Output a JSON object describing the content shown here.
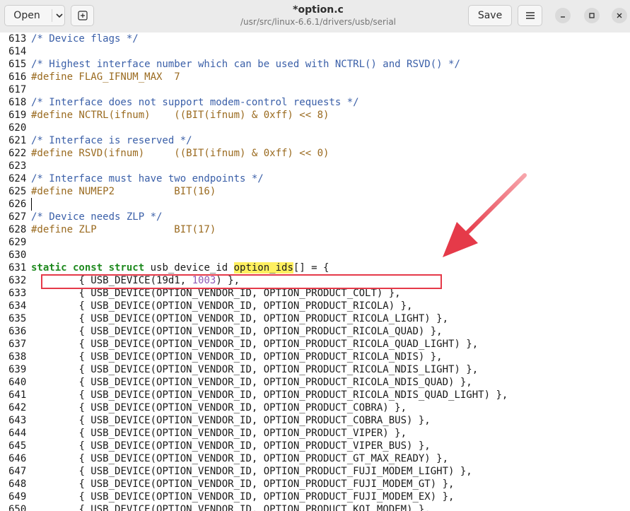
{
  "header": {
    "open_label": "Open",
    "save_label": "Save",
    "title": "*option.c",
    "subtitle": "/usr/src/linux-6.6.1/drivers/usb/serial"
  },
  "colors": {
    "comment": "#3a5fa8",
    "preproc": "#9a6a1f",
    "keyword": "#1f8a1f",
    "number": "#8e5ab5",
    "search_highlight": "#fff060",
    "annotation": "#e53a49"
  },
  "icons": {
    "open_chevron": "chevron-down-icon",
    "new_tab": "new-tab-icon",
    "menu": "hamburger-menu-icon",
    "minimize": "minimize-icon",
    "maximize": "maximize-icon",
    "close": "close-icon"
  },
  "editor": {
    "current_line": 626,
    "lines": [
      {
        "n": "613",
        "parts": [
          {
            "t": "/* Device flags */",
            "c": "comment"
          }
        ]
      },
      {
        "n": "614",
        "parts": []
      },
      {
        "n": "615",
        "parts": [
          {
            "t": "/* Highest interface number which can be used with NCTRL() and RSVD() */",
            "c": "comment"
          }
        ]
      },
      {
        "n": "616",
        "parts": [
          {
            "t": "#define FLAG_IFNUM_MAX  7",
            "c": "preproc"
          }
        ]
      },
      {
        "n": "617",
        "parts": []
      },
      {
        "n": "618",
        "parts": [
          {
            "t": "/* Interface does not support modem-control requests */",
            "c": "comment"
          }
        ]
      },
      {
        "n": "619",
        "parts": [
          {
            "t": "#define NCTRL(ifnum)    ((BIT(ifnum) & 0xff) << 8)",
            "c": "preproc"
          }
        ]
      },
      {
        "n": "620",
        "parts": []
      },
      {
        "n": "621",
        "parts": [
          {
            "t": "/* Interface is reserved */",
            "c": "comment"
          }
        ]
      },
      {
        "n": "622",
        "parts": [
          {
            "t": "#define RSVD(ifnum)     ((BIT(ifnum) & 0xff) << 0)",
            "c": "preproc"
          }
        ]
      },
      {
        "n": "623",
        "parts": []
      },
      {
        "n": "624",
        "parts": [
          {
            "t": "/* Interface must have two endpoints */",
            "c": "comment"
          }
        ]
      },
      {
        "n": "625",
        "parts": [
          {
            "t": "#define NUMEP2          BIT(16)",
            "c": "preproc"
          }
        ]
      },
      {
        "n": "626",
        "parts": []
      },
      {
        "n": "627",
        "parts": [
          {
            "t": "/* Device needs ZLP */",
            "c": "comment"
          }
        ]
      },
      {
        "n": "628",
        "parts": [
          {
            "t": "#define ZLP             BIT(17)",
            "c": "preproc"
          }
        ]
      },
      {
        "n": "629",
        "parts": []
      },
      {
        "n": "630",
        "parts": []
      },
      {
        "n": "631",
        "parts": [
          {
            "t": "static const struct",
            "c": "kw"
          },
          {
            "t": " usb_device_id ",
            "c": ""
          },
          {
            "t": "option_ids",
            "c": "hl"
          },
          {
            "t": "[] = {",
            "c": ""
          }
        ]
      },
      {
        "n": "632",
        "parts": [
          {
            "t": "\t{ USB_DEVICE(19d1, ",
            "c": ""
          },
          {
            "t": "1003",
            "c": "num"
          },
          {
            "t": ") },",
            "c": ""
          }
        ]
      },
      {
        "n": "633",
        "parts": [
          {
            "t": "\t{ USB_DEVICE(OPTION_VENDOR_ID, OPTION_PRODUCT_COLT) },",
            "c": ""
          }
        ]
      },
      {
        "n": "634",
        "parts": [
          {
            "t": "\t{ USB_DEVICE(OPTION_VENDOR_ID, OPTION_PRODUCT_RICOLA) },",
            "c": ""
          }
        ]
      },
      {
        "n": "635",
        "parts": [
          {
            "t": "\t{ USB_DEVICE(OPTION_VENDOR_ID, OPTION_PRODUCT_RICOLA_LIGHT) },",
            "c": ""
          }
        ]
      },
      {
        "n": "636",
        "parts": [
          {
            "t": "\t{ USB_DEVICE(OPTION_VENDOR_ID, OPTION_PRODUCT_RICOLA_QUAD) },",
            "c": ""
          }
        ]
      },
      {
        "n": "637",
        "parts": [
          {
            "t": "\t{ USB_DEVICE(OPTION_VENDOR_ID, OPTION_PRODUCT_RICOLA_QUAD_LIGHT) },",
            "c": ""
          }
        ]
      },
      {
        "n": "638",
        "parts": [
          {
            "t": "\t{ USB_DEVICE(OPTION_VENDOR_ID, OPTION_PRODUCT_RICOLA_NDIS) },",
            "c": ""
          }
        ]
      },
      {
        "n": "639",
        "parts": [
          {
            "t": "\t{ USB_DEVICE(OPTION_VENDOR_ID, OPTION_PRODUCT_RICOLA_NDIS_LIGHT) },",
            "c": ""
          }
        ]
      },
      {
        "n": "640",
        "parts": [
          {
            "t": "\t{ USB_DEVICE(OPTION_VENDOR_ID, OPTION_PRODUCT_RICOLA_NDIS_QUAD) },",
            "c": ""
          }
        ]
      },
      {
        "n": "641",
        "parts": [
          {
            "t": "\t{ USB_DEVICE(OPTION_VENDOR_ID, OPTION_PRODUCT_RICOLA_NDIS_QUAD_LIGHT) },",
            "c": ""
          }
        ]
      },
      {
        "n": "642",
        "parts": [
          {
            "t": "\t{ USB_DEVICE(OPTION_VENDOR_ID, OPTION_PRODUCT_COBRA) },",
            "c": ""
          }
        ]
      },
      {
        "n": "643",
        "parts": [
          {
            "t": "\t{ USB_DEVICE(OPTION_VENDOR_ID, OPTION_PRODUCT_COBRA_BUS) },",
            "c": ""
          }
        ]
      },
      {
        "n": "644",
        "parts": [
          {
            "t": "\t{ USB_DEVICE(OPTION_VENDOR_ID, OPTION_PRODUCT_VIPER) },",
            "c": ""
          }
        ]
      },
      {
        "n": "645",
        "parts": [
          {
            "t": "\t{ USB_DEVICE(OPTION_VENDOR_ID, OPTION_PRODUCT_VIPER_BUS) },",
            "c": ""
          }
        ]
      },
      {
        "n": "646",
        "parts": [
          {
            "t": "\t{ USB_DEVICE(OPTION_VENDOR_ID, OPTION_PRODUCT_GT_MAX_READY) },",
            "c": ""
          }
        ]
      },
      {
        "n": "647",
        "parts": [
          {
            "t": "\t{ USB_DEVICE(OPTION_VENDOR_ID, OPTION_PRODUCT_FUJI_MODEM_LIGHT) },",
            "c": ""
          }
        ]
      },
      {
        "n": "648",
        "parts": [
          {
            "t": "\t{ USB_DEVICE(OPTION_VENDOR_ID, OPTION_PRODUCT_FUJI_MODEM_GT) },",
            "c": ""
          }
        ]
      },
      {
        "n": "649",
        "parts": [
          {
            "t": "\t{ USB_DEVICE(OPTION_VENDOR_ID, OPTION_PRODUCT_FUJI_MODEM_EX) },",
            "c": ""
          }
        ]
      },
      {
        "n": "650",
        "parts": [
          {
            "t": "\t{ USB_DEVICE(OPTION_VENDOR_ID, OPTION_PRODUCT_KOI_MODEM) },",
            "c": ""
          }
        ]
      }
    ]
  }
}
